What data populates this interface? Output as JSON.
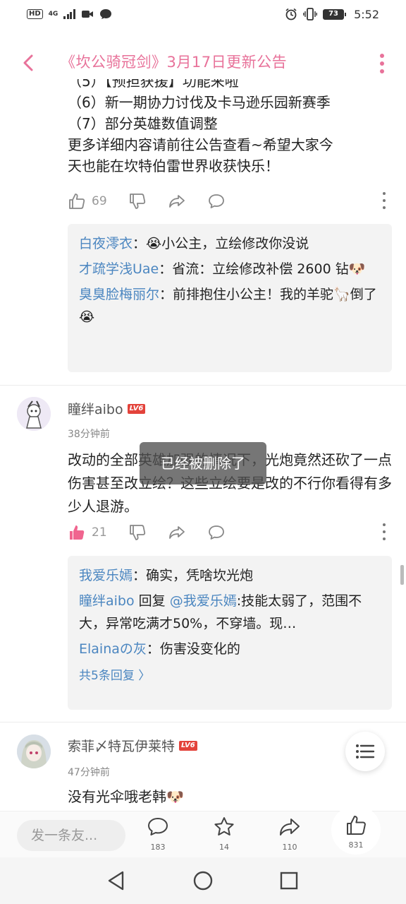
{
  "status_bar": {
    "hd": "HD",
    "network": "4G",
    "battery": "73",
    "time": "5:52"
  },
  "header": {
    "title": "《坎公骑冠剑》3月17日更新公告"
  },
  "post": {
    "lines": [
      "（5）【预担获援】功能来啦",
      "（6）新一期协力讨伐及卡马逊乐园新赛季",
      "（7）部分英雄数值调整",
      "更多详细内容请前往公告查看~希望大家今",
      "天也能在坎特伯雷世界收获快乐！"
    ],
    "likes": "69"
  },
  "post_replies": [
    {
      "name": "白夜澪衣",
      "sep": "：",
      "text": "😭小公主，立绘修改你没说"
    },
    {
      "name": "才疏学浅Uae",
      "sep": "：",
      "text": "省流：立绘修改补偿 2600 钻🐶"
    },
    {
      "name": "臭臭脸梅丽尔",
      "sep": "：",
      "text": "前排抱住小公主！我的羊驼🦙倒了😭"
    }
  ],
  "comment1": {
    "user": "瞳绊aibo",
    "level": "LV6",
    "time": "38分钟前",
    "text": "改动的全部英雄加强的情况下，光炮竟然还砍了一点伤害甚至改立绘？这些立绘要是改的不行你看得有多少人退游。",
    "likes": "21",
    "replies": [
      {
        "name": "我爱乐嫣",
        "sep": "：",
        "text": "确实，凭啥坎光炮"
      },
      {
        "name": "瞳绊aibo",
        "sep": " 回复 ",
        "mention": "@我爱乐嫣",
        "text": ":技能太弱了，范围不大，异常吃满才50%，不穿墙。现…"
      },
      {
        "name": "Elainaの灰",
        "sep": "：",
        "text": "伤害没变化的"
      }
    ],
    "more_replies": "共5条回复 〉"
  },
  "comment2": {
    "user": "索菲〆特瓦伊莱特",
    "level": "LV6",
    "time": "47分钟前",
    "text": "没有光伞哦老韩🐶"
  },
  "toast": "已经被删除了",
  "bottom_bar": {
    "input_placeholder": "发一条友...",
    "comments": "183",
    "stars": "14",
    "shares": "110",
    "likes": "831"
  },
  "colors": {
    "accent": "#e8729a",
    "name_blue": "#4b86c0",
    "liked_pink": "#f0658f",
    "level_red": "#e3433b"
  }
}
